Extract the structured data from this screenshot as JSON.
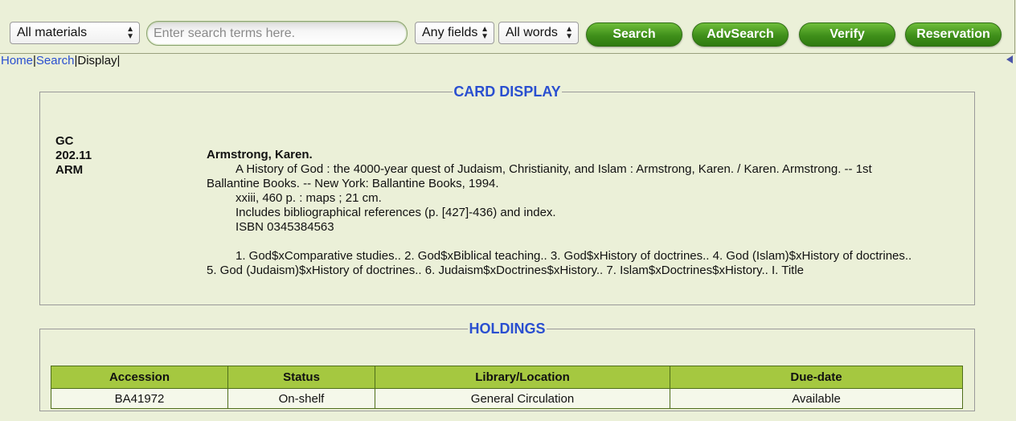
{
  "toolbar": {
    "materials_select": "All materials",
    "search_placeholder": "Enter search terms here.",
    "search_value": "",
    "fields_select": "Any fields",
    "words_select": "All words",
    "search_label": "Search",
    "advsearch_label": "AdvSearch",
    "verify_label": "Verify",
    "reservation_label": "Reservation",
    "button_color": "#3f8f1a"
  },
  "breadcrumb": {
    "home": "Home",
    "search": "Search",
    "display": "Display",
    "sep": "|"
  },
  "card": {
    "legend": "CARD DISPLAY",
    "call_number": [
      "GC",
      "202.11",
      "ARM"
    ],
    "author": "Armstrong, Karen.",
    "title_line1": "A History of God : the 4000-year quest of Judaism, Christianity, and Islam : Armstrong, Karen. / Karen. Armstrong. -- 1st",
    "title_line2": "Ballantine Books. -- New York: Ballantine Books, 1994.",
    "physical": "xxiii, 460 p. : maps ; 21 cm.",
    "notes": "Includes bibliographical references (p. [427]-436) and index.",
    "isbn": "ISBN 0345384563",
    "subjects_line1": "1. God$xComparative studies.. 2. God$xBiblical teaching.. 3. God$xHistory of doctrines.. 4. God (Islam)$xHistory of doctrines..",
    "subjects_line2": "5. God (Judaism)$xHistory of doctrines.. 6. Judaism$xDoctrines$xHistory.. 7. Islam$xDoctrines$xHistory.. I. Title"
  },
  "holdings": {
    "legend": "HOLDINGS",
    "columns": [
      "Accession",
      "Status",
      "Library/Location",
      "Due-date"
    ],
    "rows": [
      [
        "BA41972",
        "On-shelf",
        "General Circulation",
        "Available"
      ]
    ],
    "header_color": "#a5c840"
  },
  "icons": {
    "collapse": "triangle-left-icon",
    "select_arrows": "updown-arrows-icon"
  }
}
